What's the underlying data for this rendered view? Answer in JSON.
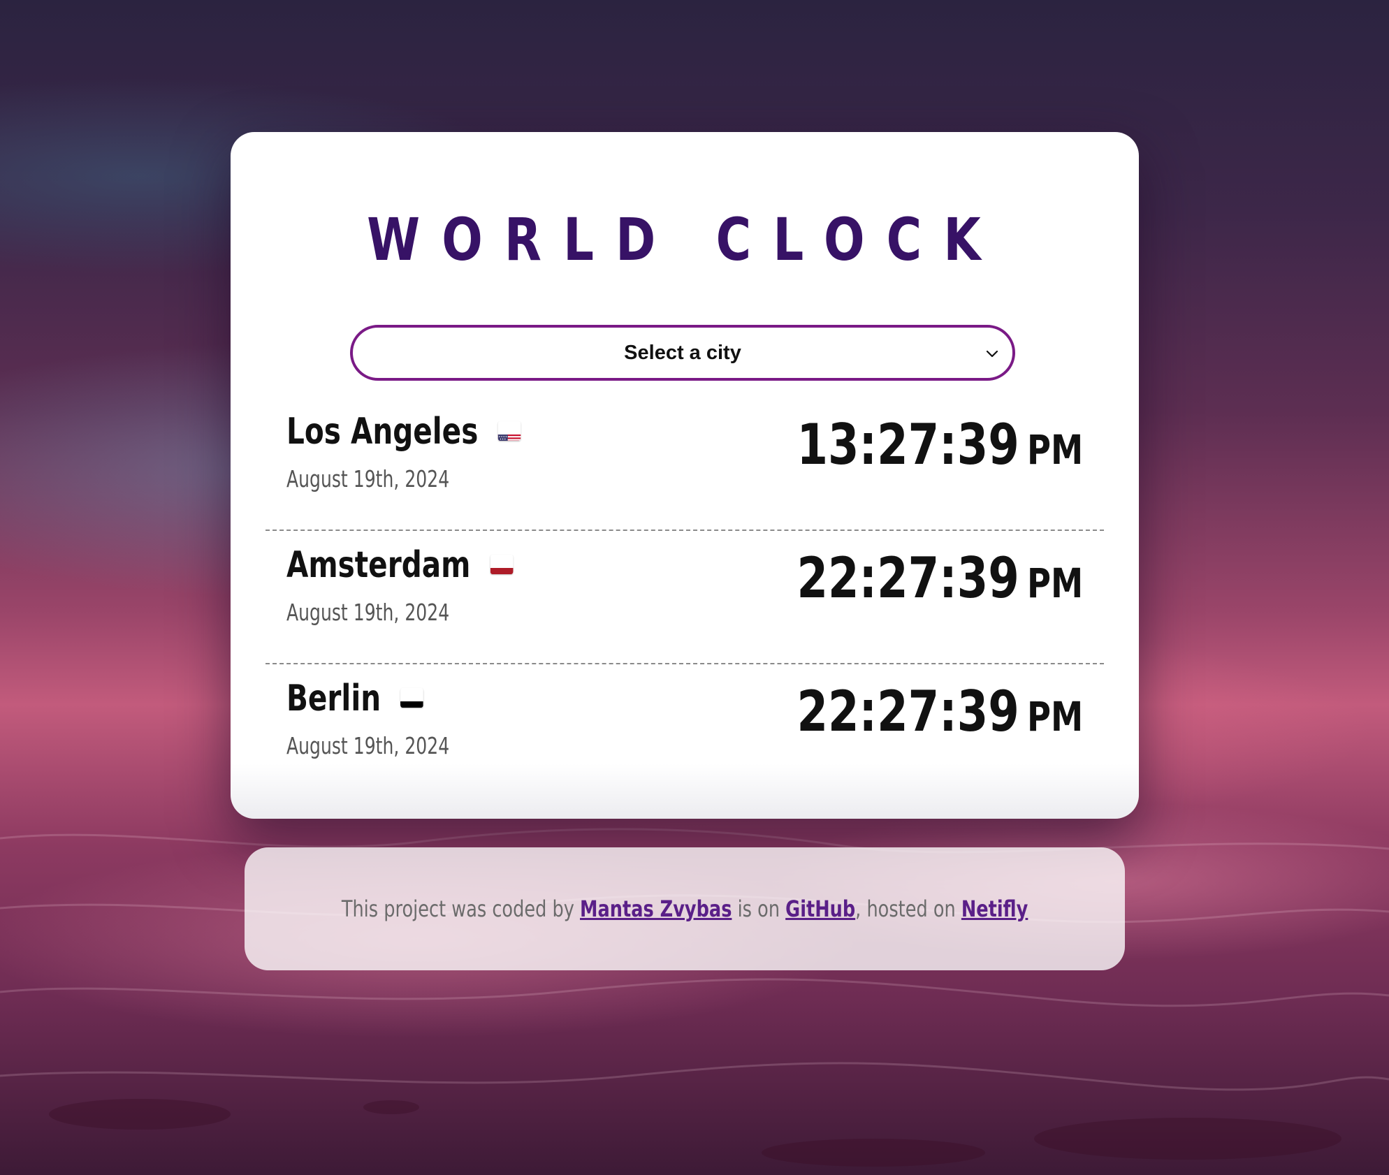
{
  "app": {
    "title": "WORLD CLOCK"
  },
  "city_select": {
    "selected_label": "Select a city"
  },
  "cities": [
    {
      "name": "Los Angeles",
      "flag": "us-flag-icon",
      "date": "August 19th, 2024",
      "time": "13:27:39",
      "ampm": "PM"
    },
    {
      "name": "Amsterdam",
      "flag": "nl-flag-icon",
      "date": "August 19th, 2024",
      "time": "22:27:39",
      "ampm": "PM"
    },
    {
      "name": "Berlin",
      "flag": "de-flag-icon",
      "date": "August 19th, 2024",
      "time": "22:27:39",
      "ampm": "PM"
    }
  ],
  "footer": {
    "text_prefix": "This project was coded by",
    "author_link": "Mantas Zvybas",
    "text_middle": "is on",
    "github_link": "GitHub",
    "text_hosted": ", hosted on",
    "host_link": "Netifly"
  },
  "colors": {
    "title": "#371266",
    "select_border": "#7a1a86",
    "link": "#5a1f88"
  }
}
